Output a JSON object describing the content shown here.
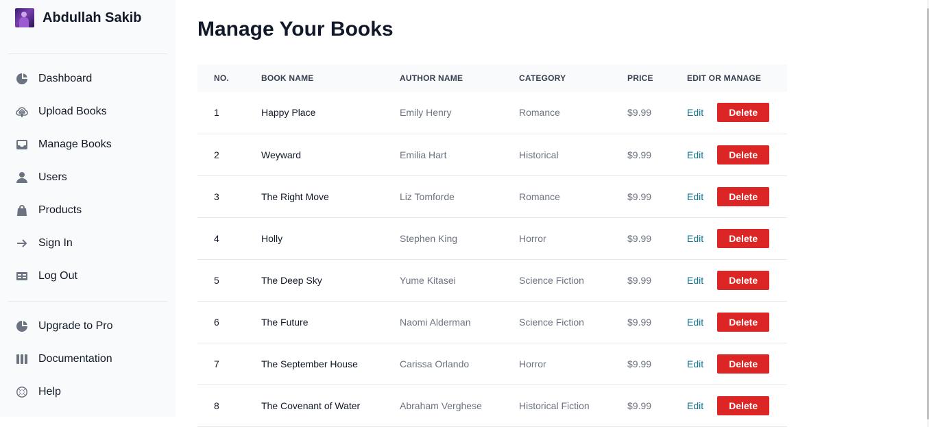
{
  "sidebar": {
    "user_name": "Abdullah Sakib",
    "items": [
      {
        "label": "Dashboard",
        "icon": "chart-pie-icon"
      },
      {
        "label": "Upload Books",
        "icon": "cloud-upload-icon"
      },
      {
        "label": "Manage Books",
        "icon": "inbox-icon"
      },
      {
        "label": "Users",
        "icon": "user-icon"
      },
      {
        "label": "Products",
        "icon": "shopping-bag-icon"
      },
      {
        "label": "Sign In",
        "icon": "arrow-right-icon"
      },
      {
        "label": "Log Out",
        "icon": "table-icon"
      }
    ],
    "secondary": [
      {
        "label": "Upgrade to Pro",
        "icon": "chart-pie-icon"
      },
      {
        "label": "Documentation",
        "icon": "columns-icon"
      },
      {
        "label": "Help",
        "icon": "lifebuoy-icon"
      }
    ]
  },
  "main": {
    "title": "Manage Your Books",
    "table": {
      "headers": [
        "No.",
        "Book Name",
        "Author Name",
        "Category",
        "Price",
        "Edit or Manage"
      ],
      "edit_label": "Edit",
      "delete_label": "Delete",
      "rows": [
        {
          "no": "1",
          "name": "Happy Place",
          "author": "Emily Henry",
          "category": "Romance",
          "price": "$9.99"
        },
        {
          "no": "2",
          "name": "Weyward",
          "author": "Emilia Hart",
          "category": "Historical",
          "price": "$9.99"
        },
        {
          "no": "3",
          "name": "The Right Move",
          "author": "Liz Tomforde",
          "category": "Romance",
          "price": "$9.99"
        },
        {
          "no": "4",
          "name": "Holly",
          "author": "Stephen King",
          "category": "Horror",
          "price": "$9.99"
        },
        {
          "no": "5",
          "name": "The Deep Sky",
          "author": "Yume Kitasei",
          "category": "Science Fiction",
          "price": "$9.99"
        },
        {
          "no": "6",
          "name": "The Future",
          "author": "Naomi Alderman",
          "category": "Science Fiction",
          "price": "$9.99"
        },
        {
          "no": "7",
          "name": "The September House",
          "author": "Carissa Orlando",
          "category": "Horror",
          "price": "$9.99"
        },
        {
          "no": "8",
          "name": "The Covenant of Water",
          "author": "Abraham Verghese",
          "category": "Historical Fiction",
          "price": "$9.99"
        }
      ]
    }
  },
  "colors": {
    "delete": "#dc2626",
    "edit_link": "#0e7490",
    "sidebar_bg": "#f9fafb"
  }
}
